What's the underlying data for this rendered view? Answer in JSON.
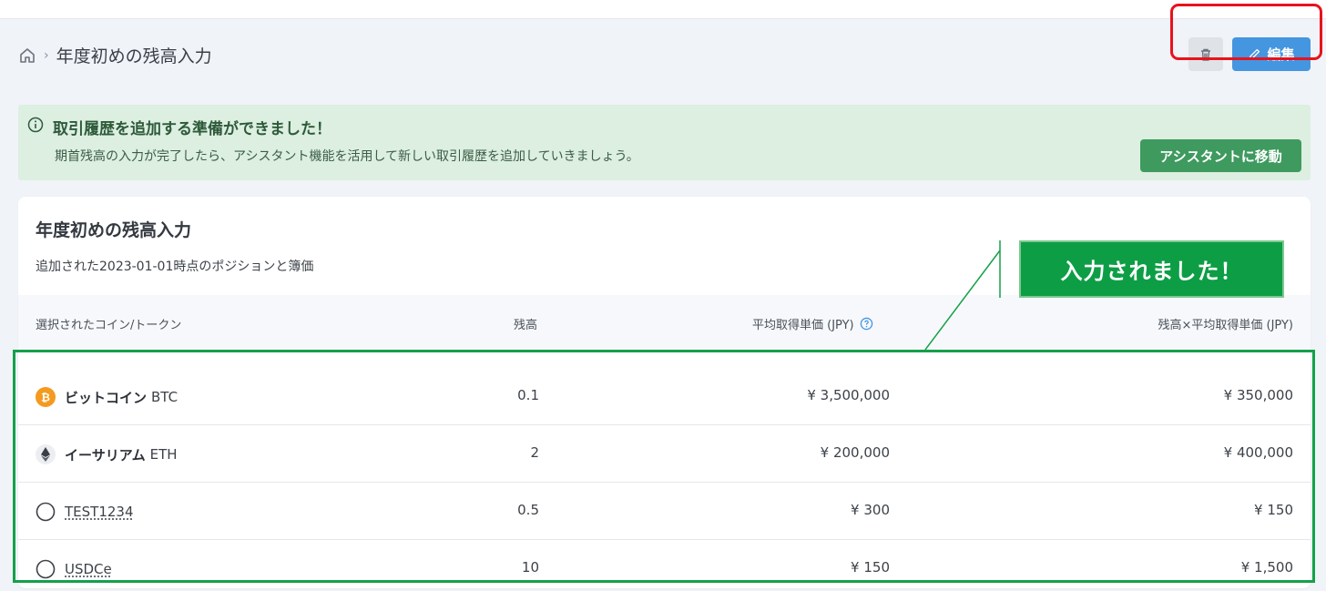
{
  "breadcrumb": {
    "separator": "›",
    "title": "年度初めの残高入力"
  },
  "actions": {
    "edit_label": "編集"
  },
  "alert": {
    "title": "取引履歴を追加する準備ができました！",
    "body": "期首残高の入力が完了したら、アシスタント機能を活用して新しい取引履歴を追加していきましょう。",
    "button_label": "アシスタントに移動"
  },
  "card": {
    "title": "年度初めの残高入力",
    "subtitle": "追加された2023-01-01時点のポジションと簿価"
  },
  "table": {
    "headers": {
      "coin": "選択されたコイン/トークン",
      "balance": "残高",
      "avg_price": "平均取得単価 (JPY)",
      "total": "残高×平均取得単価 (JPY)"
    },
    "rows": [
      {
        "name": "ビットコイン",
        "symbol": "BTC",
        "icon": "bitcoin-icon",
        "balance": "0.1",
        "avg_price": "¥ 3,500,000",
        "total": "¥ 350,000"
      },
      {
        "name": "イーサリアム",
        "symbol": "ETH",
        "icon": "ethereum-icon",
        "balance": "2",
        "avg_price": "¥ 200,000",
        "total": "¥ 400,000"
      },
      {
        "name": "TEST1234",
        "symbol": "",
        "icon": "generic-token-icon",
        "balance": "0.5",
        "avg_price": "¥ 300",
        "total": "¥ 150"
      },
      {
        "name": "USDCe",
        "symbol": "",
        "icon": "generic-token-icon",
        "balance": "10",
        "avg_price": "¥ 150",
        "total": "¥ 1,500"
      }
    ]
  },
  "annotation": {
    "callout": "入力されました！"
  },
  "colors": {
    "primary": "#4496e0",
    "success": "#3e9a5e",
    "alert_bg": "#dcefe1",
    "highlight_red": "#e8121c",
    "highlight_green": "#15a04a"
  }
}
